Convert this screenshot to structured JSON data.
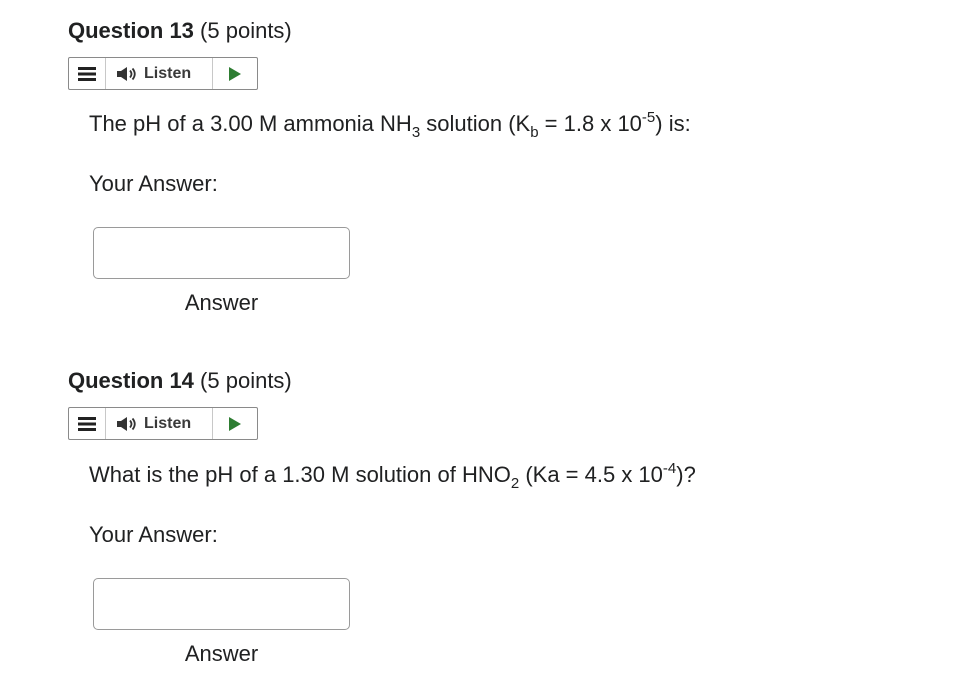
{
  "questions": [
    {
      "number_label": "Question 13",
      "points_label": "(5 points)",
      "listen_label": "Listen",
      "text": {
        "part1": "The pH of a 3.00 M ammonia NH",
        "sub1": "3",
        "part2": " solution (K",
        "sub2": "b",
        "part3": " = 1.8 x 10",
        "sup1": "-5",
        "part4": ") is:"
      },
      "your_answer_label": "Your Answer:",
      "answer_value": "",
      "answer_caption": "Answer"
    },
    {
      "number_label": "Question 14",
      "points_label": "(5 points)",
      "listen_label": "Listen",
      "text": {
        "part1": "What is the pH of a 1.30 M solution of HNO",
        "sub1": "2",
        "part2": " (Ka = 4.5 x 10",
        "sup1": "-4",
        "part3": ")?"
      },
      "your_answer_label": "Your Answer:",
      "answer_value": "",
      "answer_caption": "Answer"
    }
  ],
  "icons": {
    "menu": "menu-icon",
    "speaker": "speaker-icon",
    "play": "play-icon"
  },
  "colors": {
    "play_green": "#2e7d32",
    "text": "#202122",
    "border": "#8a8a8a"
  }
}
